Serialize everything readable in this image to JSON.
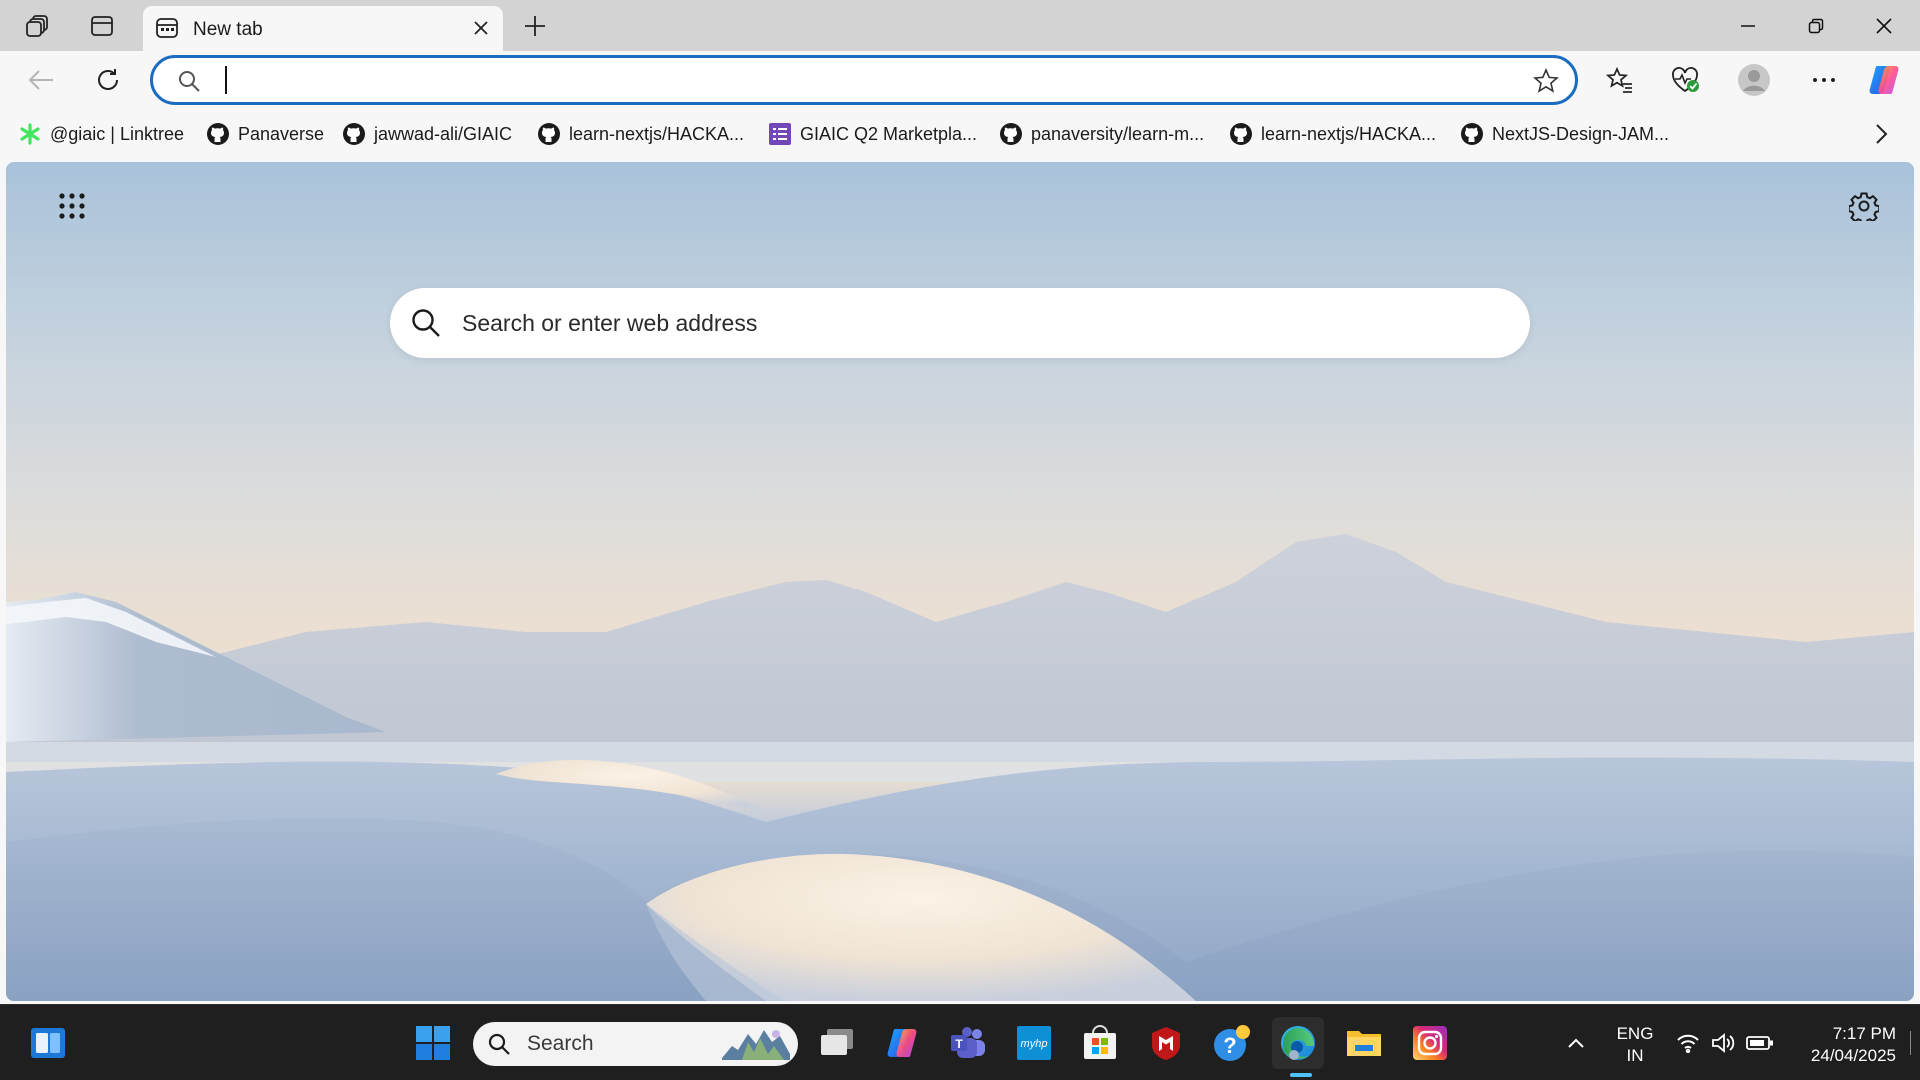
{
  "browser": {
    "tab": {
      "title": "New tab"
    },
    "omnibox": {
      "value": "",
      "placeholder": ""
    },
    "favorites": [
      {
        "label": "@giaic | Linktree",
        "icon": "linktree-icon"
      },
      {
        "label": "Panaverse",
        "icon": "github-icon"
      },
      {
        "label": "jawwad-ali/GIAIC",
        "icon": "github-icon"
      },
      {
        "label": "learn-nextjs/HACKA...",
        "icon": "github-icon"
      },
      {
        "label": "GIAIC Q2 Marketpla...",
        "icon": "forms-icon"
      },
      {
        "label": "panaversity/learn-m...",
        "icon": "github-icon"
      },
      {
        "label": "learn-nextjs/HACKA...",
        "icon": "github-icon"
      },
      {
        "label": "NextJS-Design-JAM...",
        "icon": "github-icon"
      }
    ]
  },
  "newtab": {
    "search_placeholder": "Search or enter web address"
  },
  "taskbar": {
    "search_label": "Search",
    "language": {
      "line1": "ENG",
      "line2": "IN"
    },
    "clock": {
      "time": "7:17 PM",
      "date": "24/04/2025"
    }
  },
  "colors": {
    "accent": "#1b6dc1",
    "taskbar_bg": "#1f1f1f",
    "chrome_bg": "#f7f7f7",
    "titlebar_bg": "#d3d3d3"
  }
}
